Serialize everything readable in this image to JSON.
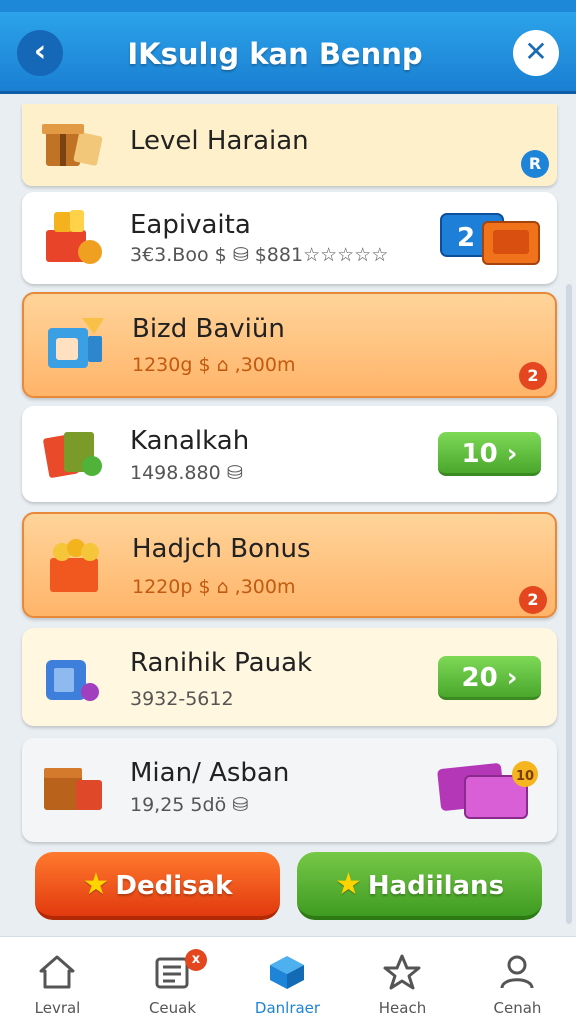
{
  "header": {
    "title": "IKsulıg kan Bennp",
    "back_icon": "‹",
    "close_icon": "✕"
  },
  "cards": [
    {
      "title": "Level Haraian",
      "icon": "gift-box-icon",
      "badge": "R"
    },
    {
      "title": "Eapivaita",
      "subtitle": "3€3.Boo $ ⛁ $881☆☆☆☆☆",
      "icon": "gift-basket-icon",
      "reward": "2",
      "reward_icon": "ticket-icon"
    },
    {
      "title": "Bizd Baviün",
      "subtitle": "1230g $ ⌂ ,300m",
      "icon": "blue-cube-icon",
      "badge": "2"
    },
    {
      "title": "Kanalkah",
      "subtitle": "1498.880 ⛁",
      "icon": "cards-icon",
      "pill": "10 ›"
    },
    {
      "title": "Hadjch Bonus",
      "subtitle": "1220p $ ⌂ ,300m",
      "icon": "coin-basket-icon",
      "badge": "2"
    },
    {
      "title": "Ranihik Pauak",
      "subtitle": "3932-5612",
      "icon": "blue-bag-icon",
      "pill": "20 ›"
    },
    {
      "title": "Mian/ Asban",
      "subtitle": "19,25 5dö ⛁",
      "icon": "treasure-chest-icon",
      "reward_icon": "purple-ticket-icon",
      "reward_badge": "10"
    }
  ],
  "buttons": {
    "left": "Dedisak",
    "right": "Hadiilans",
    "star": "★"
  },
  "tabs": [
    {
      "label": "Levral",
      "icon": "home-icon"
    },
    {
      "label": "Ceuak",
      "icon": "news-icon",
      "badge": "x"
    },
    {
      "label": "Danlraer",
      "icon": "cube-icon"
    },
    {
      "label": "Heach",
      "icon": "star-icon"
    },
    {
      "label": "Cenah",
      "icon": "profile-icon"
    }
  ],
  "colors": {
    "header_blue": "#1a7fd2",
    "accent_orange": "#ff9a45",
    "accent_green": "#4aa72c",
    "active_tab": "#1d84d8"
  }
}
